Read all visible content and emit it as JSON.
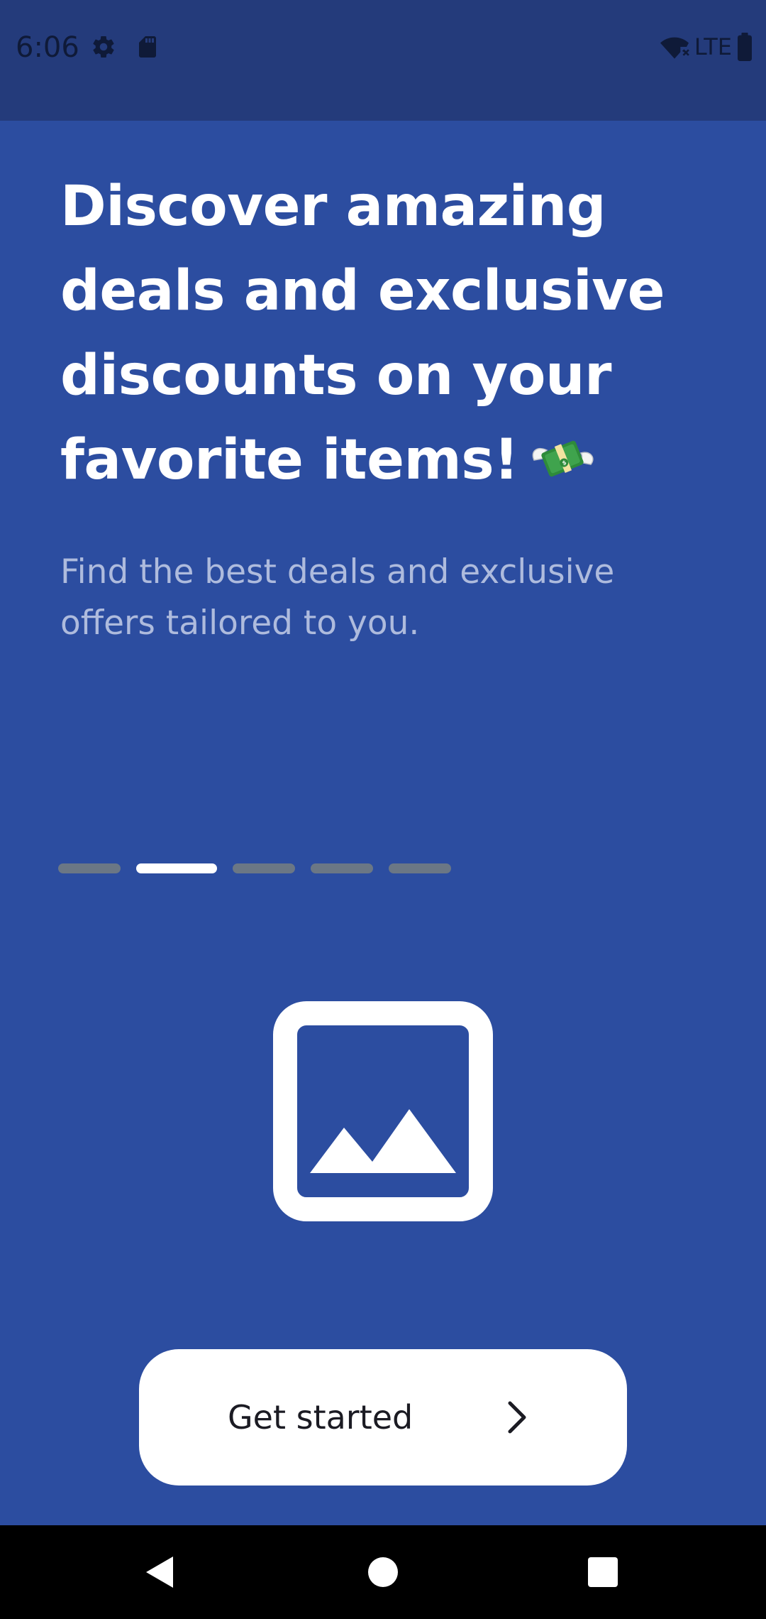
{
  "status_bar": {
    "time": "6:06",
    "network_label": "LTE",
    "icons": [
      "settings-icon",
      "sd-card-icon",
      "wifi-off-icon",
      "battery-icon"
    ]
  },
  "onboarding": {
    "headline": "Discover amazing deals and exclusive discounts on your favorite items!",
    "headline_emoji": "money-with-wings-icon",
    "subtext": "Find the best deals and exclusive offers tailored to you.",
    "pager": {
      "total_pages": 5,
      "current_page": 2
    },
    "image_icon": "image-placeholder-icon"
  },
  "cta": {
    "label": "Get started",
    "icon": "chevron-right-icon"
  },
  "nav_bar": {
    "buttons": [
      "back-icon",
      "home-icon",
      "recents-icon"
    ]
  },
  "colors": {
    "background": "#2C4DA0",
    "status_bar": "#243B7B",
    "text_primary": "#FFFFFF",
    "text_secondary": "#AEBBDD",
    "pager_inactive": "#6B7785",
    "pager_active": "#FFFFFF",
    "button_bg": "#FFFFFF",
    "button_text": "#1B1B23"
  }
}
